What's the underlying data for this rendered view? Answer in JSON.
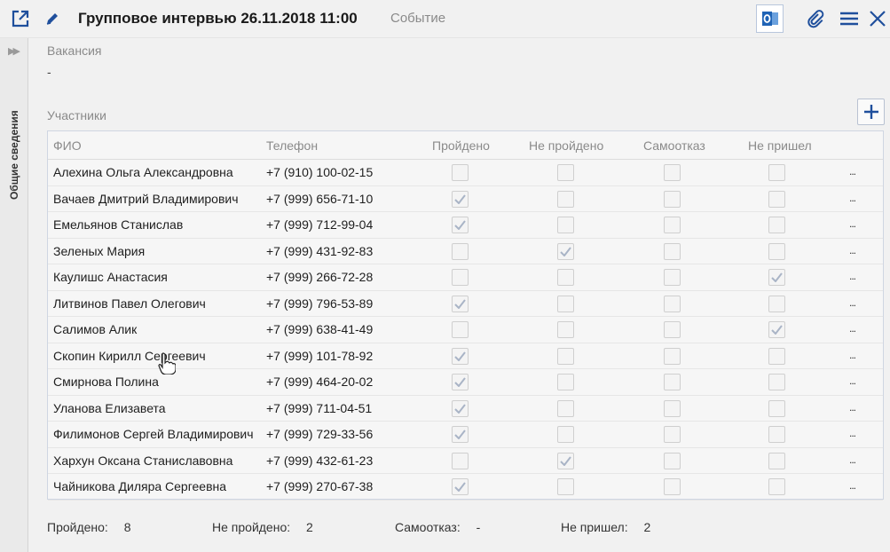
{
  "header": {
    "title": "Групповое интервью 26.11.2018 11:00",
    "subtitle": "Событие"
  },
  "sidebar": {
    "tab_label": "Общие сведения"
  },
  "vacancy": {
    "label": "Вакансия",
    "value": "-"
  },
  "participants": {
    "label": "Участники",
    "columns": [
      "ФИО",
      "Телефон",
      "Пройдено",
      "Не пройдено",
      "Самоотказ",
      "Не пришел"
    ],
    "more_label": "...",
    "rows": [
      {
        "name": "Алехина Ольга Александровна",
        "phone": "+7 (910) 100-02-15",
        "status": "none"
      },
      {
        "name": "Вачаев Дмитрий Владимирович",
        "phone": "+7 (999) 656-71-10",
        "status": "passed"
      },
      {
        "name": "Емельянов Станислав",
        "phone": "+7 (999) 712-99-04",
        "status": "passed"
      },
      {
        "name": "Зеленых Мария",
        "phone": "+7 (999) 431-92-83",
        "status": "failed"
      },
      {
        "name": "Каулишс Анастасия",
        "phone": "+7 (999) 266-72-28",
        "status": "no_show"
      },
      {
        "name": "Литвинов Павел Олегович",
        "phone": "+7 (999) 796-53-89",
        "status": "passed"
      },
      {
        "name": "Салимов Алик",
        "phone": "+7 (999) 638-41-49",
        "status": "no_show"
      },
      {
        "name": "Скопин Кирилл Сергеевич",
        "phone": "+7 (999) 101-78-92",
        "status": "passed"
      },
      {
        "name": "Смирнова Полина",
        "phone": "+7 (999) 464-20-02",
        "status": "passed"
      },
      {
        "name": "Уланова Елизавета",
        "phone": "+7 (999) 711-04-51",
        "status": "passed"
      },
      {
        "name": "Филимонов Сергей Владимирович",
        "phone": "+7 (999) 729-33-56",
        "status": "passed"
      },
      {
        "name": "Хархун Оксана Станиславовна",
        "phone": "+7 (999) 432-61-23",
        "status": "failed"
      },
      {
        "name": "Чайникова Диляра Сергеевна",
        "phone": "+7 (999) 270-67-38",
        "status": "passed"
      }
    ]
  },
  "summary": {
    "passed_label": "Пройдено:",
    "passed_value": "8",
    "failed_label": "Не пройдено:",
    "failed_value": "2",
    "refused_label": "Самоотказ:",
    "refused_value": "-",
    "no_show_label": "Не пришел:",
    "no_show_value": "2"
  },
  "colors": {
    "accent": "#1f4f9c",
    "outlook": "#1f63b5",
    "check": "#a9b4c6"
  },
  "icons": [
    "open-in-new-icon",
    "edit-pencil-icon",
    "outlook-icon",
    "paperclip-icon",
    "menu-icon",
    "close-icon",
    "expand-arrows-icon",
    "plus-icon",
    "checkmark-icon",
    "hand-cursor-icon"
  ]
}
